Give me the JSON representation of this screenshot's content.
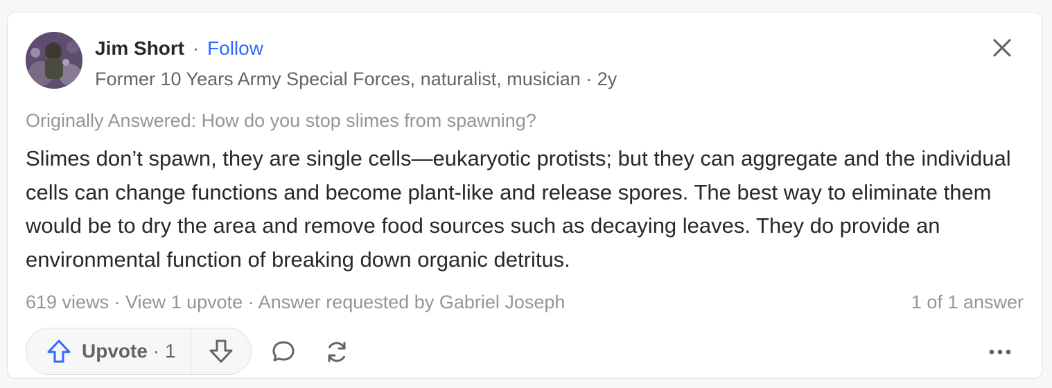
{
  "author": {
    "name": "Jim Short",
    "separator": "·",
    "follow_label": "Follow",
    "credential": "Former 10 Years Army Special Forces, naturalist, musician · 2y"
  },
  "question": {
    "originally_answered": "Originally Answered: How do you stop slimes from spawning?"
  },
  "answer": {
    "text": "Slimes don’t spawn, they are single cells—eukaryotic protists; but they can aggregate and the individual cells can change functions and become plant-like and release spores. The best way to eliminate them would be to dry the area and remove food sources such as decaying leaves. They do provide an environmental function of breaking down organic detritus."
  },
  "meta": {
    "stats": "619 views · View 1 upvote · Answer requested by Gabriel Joseph",
    "position": "1 of 1 answer"
  },
  "actions": {
    "upvote_label": "Upvote",
    "upvote_count": "· 1"
  },
  "icons": {
    "close": "close-icon",
    "upvote": "arrow-up-icon",
    "downvote": "arrow-down-icon",
    "comment": "comment-icon",
    "share": "share-icon",
    "more": "more-icon"
  },
  "colors": {
    "accent": "#2e69ff",
    "text": "#282829",
    "muted": "#939598"
  }
}
